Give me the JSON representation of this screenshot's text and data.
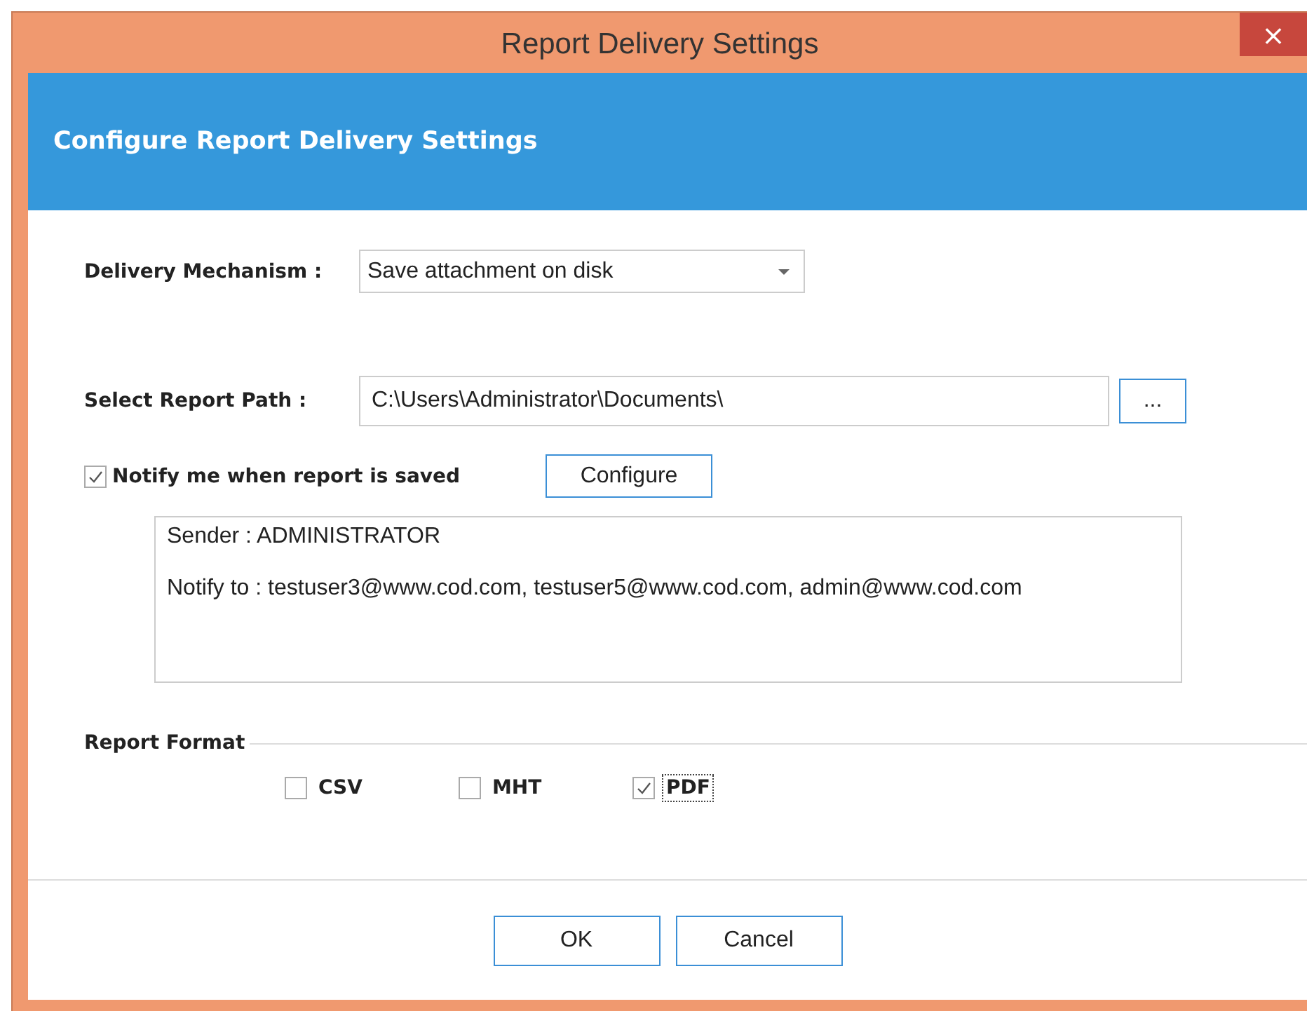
{
  "window": {
    "title": "Report Delivery Settings",
    "close": "×"
  },
  "header": {
    "title": "Configure Report Delivery Settings"
  },
  "delivery": {
    "label": "Delivery Mechanism :",
    "value": "Save attachment on disk"
  },
  "report_path": {
    "label": "Select Report Path :",
    "value": "C:\\Users\\Administrator\\Documents\\",
    "browse": "..."
  },
  "notify": {
    "label": "Notify me when report is saved",
    "checked": true,
    "configure": "Configure"
  },
  "notify_details": [
    "Sender : ADMINISTRATOR",
    "Notify to : testuser3@www.cod.com, testuser5@www.cod.com, admin@www.cod.com"
  ],
  "report_format": {
    "title": "Report Format",
    "options": [
      {
        "label": "CSV",
        "checked": false,
        "focused": false
      },
      {
        "label": "MHT",
        "checked": false,
        "focused": false
      },
      {
        "label": "PDF",
        "checked": true,
        "focused": true
      }
    ]
  },
  "buttons": [
    {
      "label": "OK"
    },
    {
      "label": "Cancel"
    }
  ]
}
